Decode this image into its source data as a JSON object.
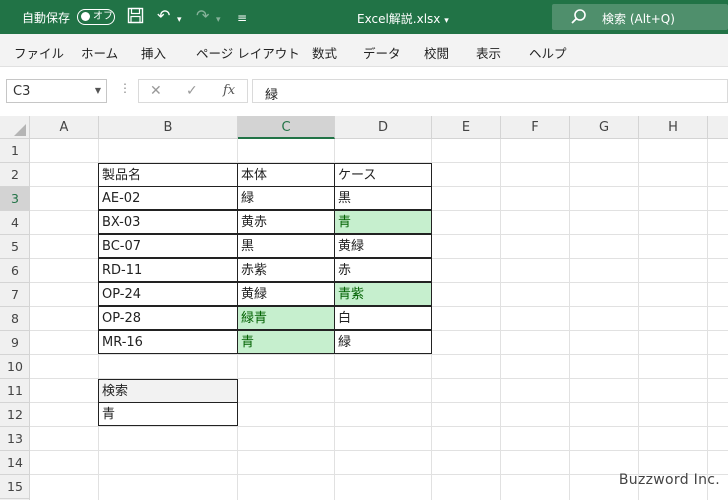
{
  "titlebar": {
    "autosave_label": "自動保存",
    "autosave_state": "オフ",
    "filename": "Excel解説.xlsx",
    "search_text": "検索 (Alt+Q)"
  },
  "ribbon": {
    "tabs": [
      "ファイル",
      "ホーム",
      "挿入",
      "ページ レイアウト",
      "数式",
      "データ",
      "校閲",
      "表示",
      "ヘルプ"
    ]
  },
  "formula_bar": {
    "name_box": "C3",
    "content": "緑"
  },
  "grid": {
    "columns": [
      "A",
      "B",
      "C",
      "D",
      "E",
      "F",
      "G",
      "H"
    ],
    "rows": [
      "1",
      "2",
      "3",
      "4",
      "5",
      "6",
      "7",
      "8",
      "9",
      "10",
      "11",
      "12",
      "13",
      "14",
      "15"
    ],
    "table": {
      "header": [
        "製品名",
        "本体",
        "ケース"
      ],
      "rows": [
        [
          "AE-02",
          "緑",
          "黒"
        ],
        [
          "BX-03",
          "黄赤",
          "青"
        ],
        [
          "BC-07",
          "黒",
          "黄緑"
        ],
        [
          "RD-11",
          "赤紫",
          "赤"
        ],
        [
          "OP-24",
          "黄緑",
          "青紫"
        ],
        [
          "OP-28",
          "緑青",
          "白"
        ],
        [
          "MR-16",
          "青",
          "緑"
        ]
      ]
    },
    "search_box": {
      "label": "検索",
      "value": "青"
    }
  },
  "colors": {
    "excel_green": "#217346",
    "highlight_fill": "#c6efce",
    "highlight_text": "#006100"
  },
  "watermark": "Buzzword Inc."
}
